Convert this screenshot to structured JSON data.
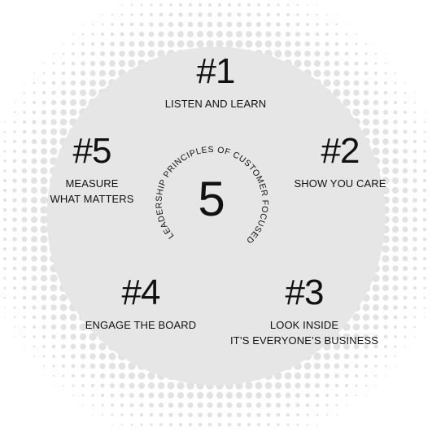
{
  "colors": {
    "background": "#ffffff",
    "disc": "#e6e6e6",
    "dots": "#e2e2e2",
    "text": "#111111"
  },
  "center": {
    "number": "5",
    "ring_text": "LEADERSHIP PRINCIPLES OF CUSTOMER FOCUSED"
  },
  "principles": [
    {
      "number": "#1",
      "label_lines": [
        "LISTEN AND LEARN"
      ]
    },
    {
      "number": "#2",
      "label_lines": [
        "SHOW YOU CARE"
      ]
    },
    {
      "number": "#3",
      "label_lines": [
        "LOOK INSIDE",
        "IT’S EVERYONE’S BUSINESS"
      ]
    },
    {
      "number": "#4",
      "label_lines": [
        "ENGAGE THE BOARD"
      ]
    },
    {
      "number": "#5",
      "label_lines": [
        "MEASURE",
        "WHAT MATTERS"
      ]
    }
  ]
}
